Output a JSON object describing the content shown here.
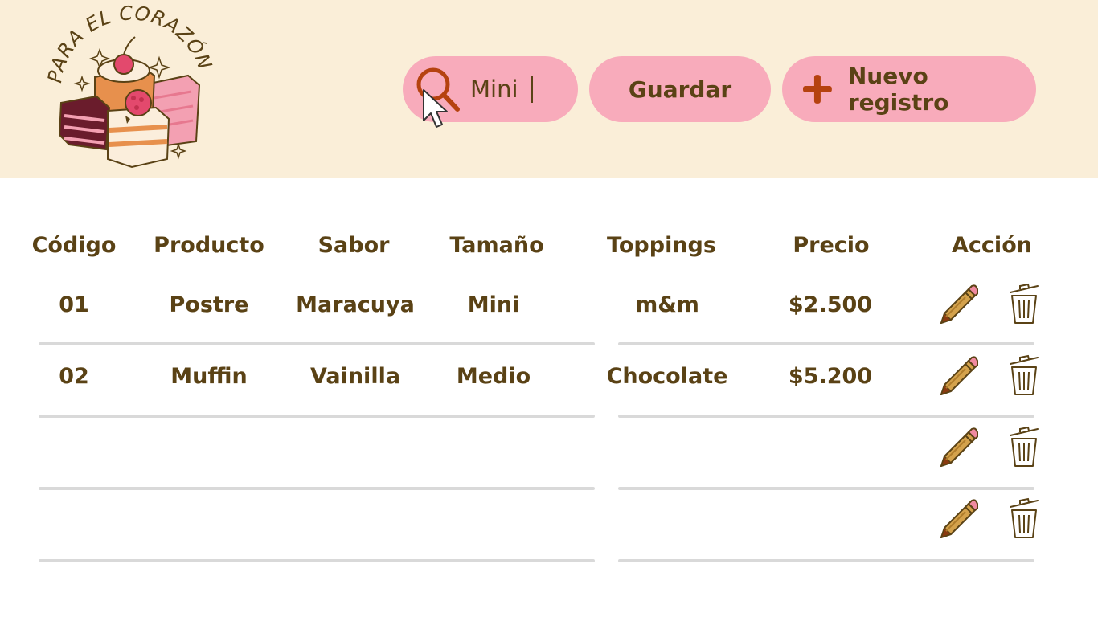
{
  "brand": {
    "logo_text": "PARA EL CORAZÓN",
    "logo_icon": "cupcakes-logo"
  },
  "toolbar": {
    "search_icon": "search-icon",
    "search_value": "Mini",
    "save_label": "Guardar",
    "new_icon": "plus-icon",
    "new_label": "Nuevo registro"
  },
  "table": {
    "headers": {
      "codigo": "Código",
      "producto": "Producto",
      "sabor": "Sabor",
      "tamano": "Tamaño",
      "toppings": "Toppings",
      "precio": "Precio",
      "accion": "Acción"
    },
    "rows": [
      {
        "codigo": "01",
        "producto": "Postre",
        "sabor": "Maracuya",
        "tamano": "Mini",
        "toppings": "m&m",
        "precio": "$2.500"
      },
      {
        "codigo": "02",
        "producto": "Muffin",
        "sabor": "Vainilla",
        "tamano": "Medio",
        "toppings": "Chocolate",
        "precio": "$5.200"
      },
      {
        "codigo": "",
        "producto": "",
        "sabor": "",
        "tamano": "",
        "toppings": "",
        "precio": ""
      },
      {
        "codigo": "",
        "producto": "",
        "sabor": "",
        "tamano": "",
        "toppings": "",
        "precio": ""
      }
    ],
    "action_icons": [
      "pencil-icon",
      "trash-icon"
    ]
  },
  "colors": {
    "header_bg": "#faeed8",
    "pill_bg": "#f8abbb",
    "text": "#5a4215",
    "accent": "#b5420f",
    "divider": "#d9d9d9"
  }
}
